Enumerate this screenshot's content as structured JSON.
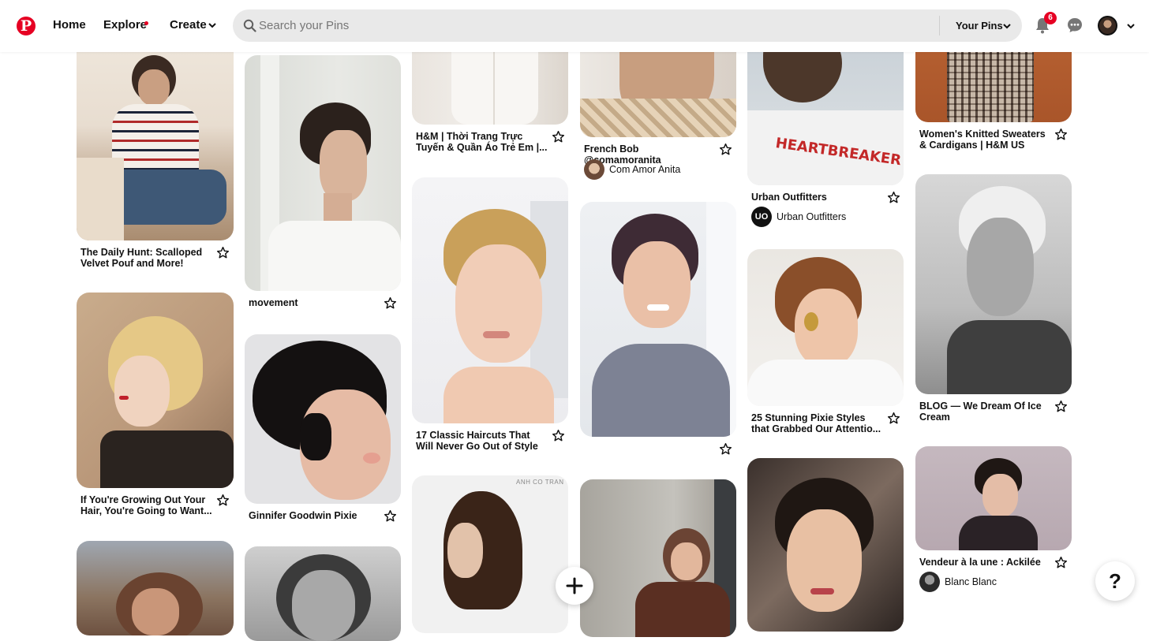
{
  "header": {
    "logo_icon": "pinterest-logo-icon",
    "nav": {
      "home": "Home",
      "explore": "Explore",
      "create": "Create"
    },
    "search": {
      "placeholder": "Search your Pins"
    },
    "your_pins": "Your Pins",
    "notifications_count": "6",
    "accent_color": "#e60023"
  },
  "pins": [
    {
      "title": "The Daily Hunt: Scalloped Velvet Pouf and More!",
      "image": "woman in striped sweater and jeans sitting"
    },
    {
      "title": "If You're Growing Out Your Hair, You're Going to Want...",
      "image": "blonde pixie profile"
    },
    {
      "title": "",
      "image": "woman with wavy brown hair"
    },
    {
      "title": "movement",
      "image": "dark pixie profile, white shirt"
    },
    {
      "title": "Ginnifer Goodwin Pixie",
      "image": "black pixie haircut profile"
    },
    {
      "title": "",
      "image": "black and white portrait"
    },
    {
      "title": "H&M | Thời Trang Trực Tuyến & Quần Áo Trẻ Em |...",
      "image": "white blouse"
    },
    {
      "title": "17 Classic Haircuts That Will Never Go Out of Style",
      "image": "blonde pixie portrait"
    },
    {
      "title": "",
      "image": "short bob from behind",
      "watermark": "ANH CO TRAN"
    },
    {
      "title": "French Bob @comamoranita",
      "owner": "Com Amor Anita",
      "image": "neck tattoo closeup"
    },
    {
      "title": "",
      "image": "smiling woman in grey sweater"
    },
    {
      "title": "",
      "image": "woman in brown jacket at table"
    },
    {
      "title": "Urban Outfitters",
      "owner": "Urban Outfitters",
      "owner_initials": "UO",
      "image": "heartbreaker t-shirt"
    },
    {
      "title": "25 Stunning Pixie Styles that Grabbed Our Attentio...",
      "image": "auburn pixie with gold earrings"
    },
    {
      "title": "",
      "image": "curly short hair on red carpet"
    },
    {
      "title": "Women's Knitted Sweaters & Cardigans | H&M US",
      "image": "plaid trousers"
    },
    {
      "title": "BLOG — We Dream Of Ice Cream",
      "image": "black and white platinum pixie"
    },
    {
      "title": "Vendeur à la une : Ackilée",
      "owner": "Blanc Blanc",
      "image": "dark pixie smiling"
    }
  ],
  "help_label": "?"
}
